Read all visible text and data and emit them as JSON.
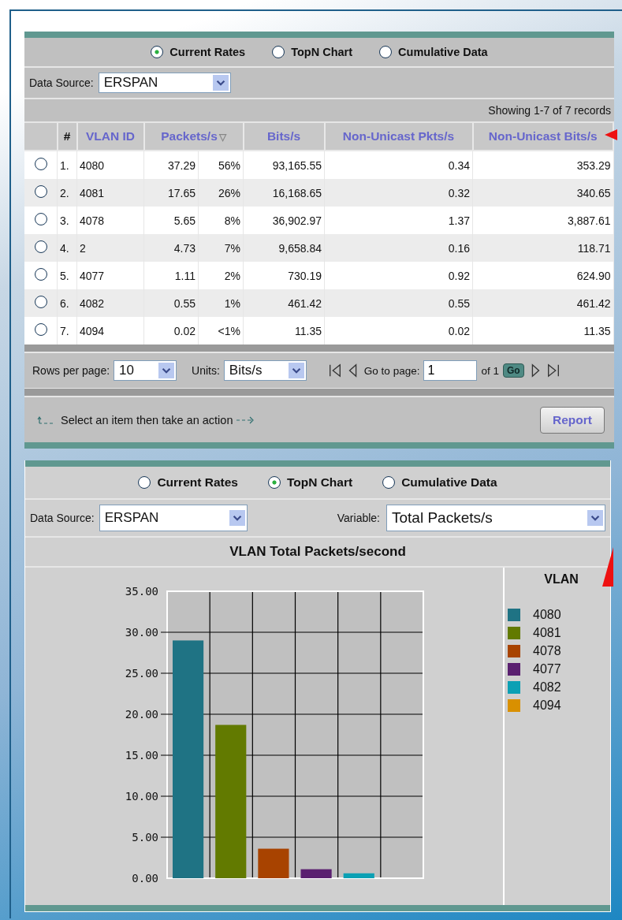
{
  "rates_panel": {
    "view_options": [
      {
        "label": "Current Rates",
        "selected": true
      },
      {
        "label": "TopN Chart",
        "selected": false
      },
      {
        "label": "Cumulative Data",
        "selected": false
      }
    ],
    "data_source": {
      "label": "Data Source:",
      "value": "ERSPAN"
    },
    "record_count": "Showing 1-7 of 7 records",
    "table": {
      "columns": [
        "#",
        "VLAN ID",
        "Packets/s",
        "Bits/s",
        "Non-Unicast Pkts/s",
        "Non-Unicast Bits/s"
      ],
      "sort_mark": "▽",
      "rows": [
        {
          "selected": false,
          "num": "1.",
          "vlan": "4080",
          "packets": "37.29",
          "share": "56%",
          "bits": "93,165.55",
          "nu_pkts": "0.34",
          "nu_bits": "353.29"
        },
        {
          "selected": false,
          "num": "2.",
          "vlan": "4081",
          "packets": "17.65",
          "share": "26%",
          "bits": "16,168.65",
          "nu_pkts": "0.32",
          "nu_bits": "340.65"
        },
        {
          "selected": false,
          "num": "3.",
          "vlan": "4078",
          "packets": "5.65",
          "share": "8%",
          "bits": "36,902.97",
          "nu_pkts": "1.37",
          "nu_bits": "3,887.61"
        },
        {
          "selected": false,
          "num": "4.",
          "vlan": "2",
          "packets": "4.73",
          "share": "7%",
          "bits": "9,658.84",
          "nu_pkts": "0.16",
          "nu_bits": "118.71"
        },
        {
          "selected": false,
          "num": "5.",
          "vlan": "4077",
          "packets": "1.11",
          "share": "2%",
          "bits": "730.19",
          "nu_pkts": "0.92",
          "nu_bits": "624.90"
        },
        {
          "selected": false,
          "num": "6.",
          "vlan": "4082",
          "packets": "0.55",
          "share": "1%",
          "bits": "461.42",
          "nu_pkts": "0.55",
          "nu_bits": "461.42"
        },
        {
          "selected": false,
          "num": "7.",
          "vlan": "4094",
          "packets": "0.02",
          "share": "<1%",
          "bits": "11.35",
          "nu_pkts": "0.02",
          "nu_bits": "11.35"
        }
      ]
    },
    "pagination": {
      "rows_label": "Rows per page:",
      "rows_value": "10",
      "units_label": "Units:",
      "units_value": "Bits/s",
      "goto_label": "Go to page:",
      "page_value": "1",
      "page_total": "of 1",
      "go_button": "Go"
    },
    "action_hint": "Select an item then take an action",
    "report_button": "Report"
  },
  "topn_panel": {
    "view_options": [
      {
        "label": "Current Rates",
        "selected": false
      },
      {
        "label": "TopN Chart",
        "selected": true
      },
      {
        "label": "Cumulative Data",
        "selected": false
      }
    ],
    "data_source": {
      "label": "Data Source:",
      "value": "ERSPAN"
    },
    "variable": {
      "label": "Variable:",
      "value": "Total Packets/s"
    },
    "legend_title": "VLAN",
    "chart_data": {
      "type": "bar",
      "title": "VLAN Total Packets/second",
      "grid": true,
      "ylim": [
        0,
        35
      ],
      "yticks": [
        {
          "value": 0,
          "label": "0.00"
        },
        {
          "value": 5,
          "label": "5.00"
        },
        {
          "value": 10,
          "label": "10.00"
        },
        {
          "value": 15,
          "label": "15.00"
        },
        {
          "value": 20,
          "label": "20.00"
        },
        {
          "value": 25,
          "label": "25.00"
        },
        {
          "value": 30,
          "label": "30.00"
        },
        {
          "value": 35,
          "label": "35.00"
        }
      ],
      "series": [
        {
          "name": "4080",
          "color": "#1f7384",
          "values": [
            29.0
          ]
        },
        {
          "name": "4081",
          "color": "#627a00",
          "values": [
            18.7
          ]
        },
        {
          "name": "4078",
          "color": "#a84300",
          "values": [
            3.6
          ]
        },
        {
          "name": "4077",
          "color": "#5a2070",
          "values": [
            1.1
          ]
        },
        {
          "name": "4082",
          "color": "#0ba0b4",
          "values": [
            0.6
          ]
        },
        {
          "name": "4094",
          "color": "#d99000",
          "values": [
            0.0
          ]
        }
      ]
    }
  }
}
